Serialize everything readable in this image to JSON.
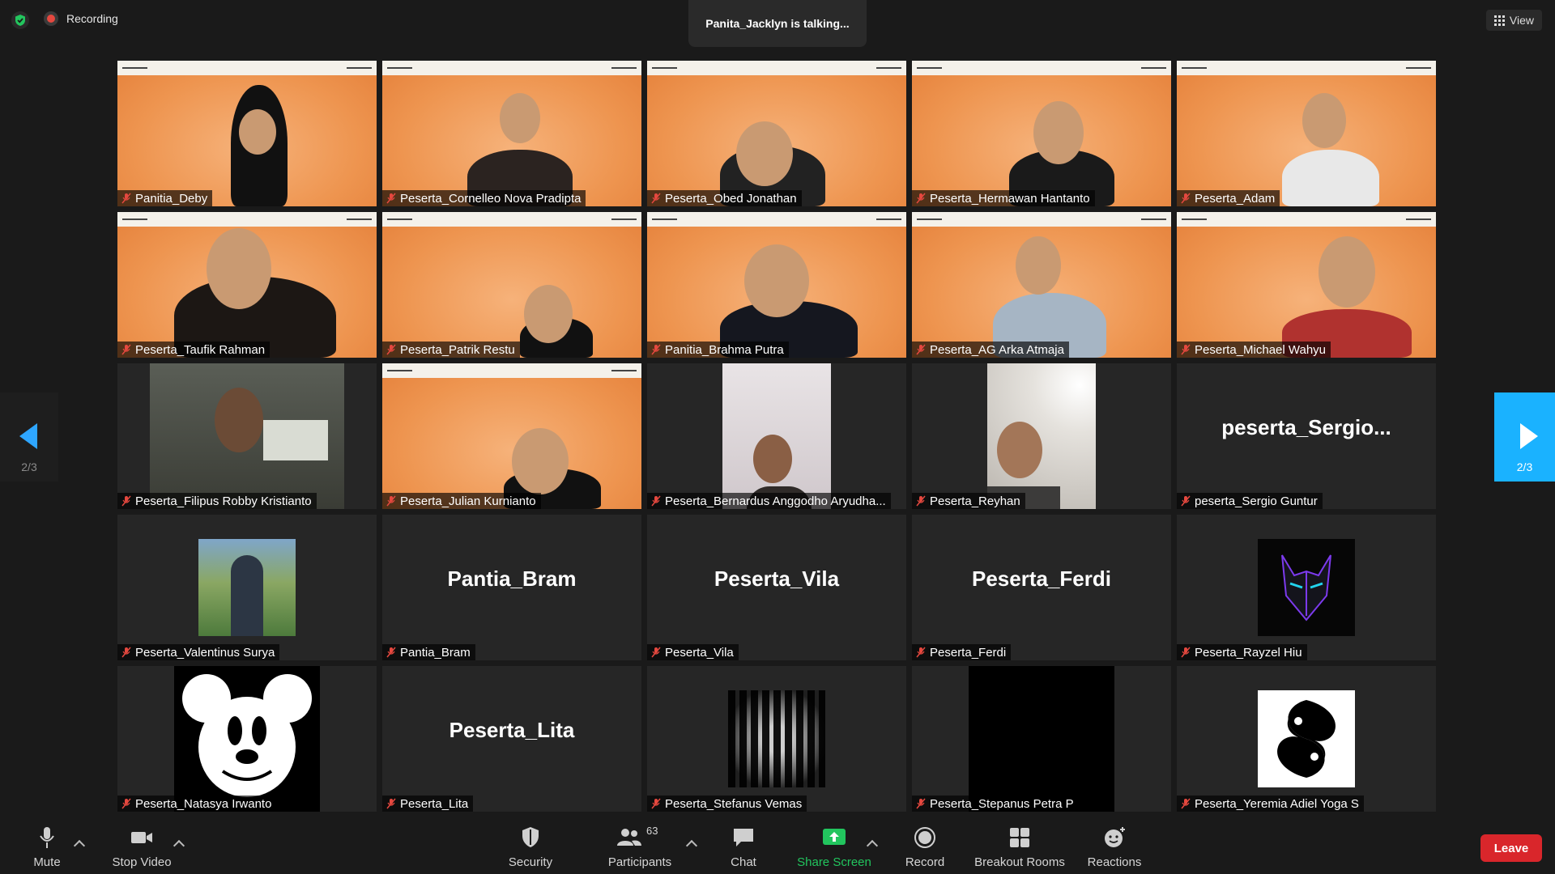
{
  "top": {
    "recording_label": "Recording",
    "talking": "Panita_Jacklyn is talking...",
    "view_label": "View"
  },
  "pager": {
    "left_label": "2/3",
    "right_label": "2/3"
  },
  "tiles": [
    {
      "name": "Panitia_Deby",
      "kind": "video"
    },
    {
      "name": "Peserta_Cornelleo Nova Pradipta",
      "kind": "video"
    },
    {
      "name": "Peserta_Obed Jonathan",
      "kind": "video"
    },
    {
      "name": "Peserta_Hermawan Hantanto",
      "kind": "video"
    },
    {
      "name": "Peserta_Adam",
      "kind": "video"
    },
    {
      "name": "Peserta_Taufik Rahman",
      "kind": "video"
    },
    {
      "name": "Peserta_Patrik Restu",
      "kind": "video"
    },
    {
      "name": "Panitia_Brahma Putra",
      "kind": "video"
    },
    {
      "name": "Peserta_AG Arka Atmaja",
      "kind": "video"
    },
    {
      "name": "Peserta_Michael Wahyu",
      "kind": "video"
    },
    {
      "name": "Peserta_Filipus Robby Kristianto",
      "kind": "video"
    },
    {
      "name": "Peserta_Julian Kurnianto",
      "kind": "video"
    },
    {
      "name": "Peserta_Bernardus Anggodho Aryudha...",
      "kind": "video"
    },
    {
      "name": "Peserta_Reyhan",
      "kind": "video"
    },
    {
      "name": "peserta_Sergio Guntur",
      "kind": "text",
      "display": "peserta_Sergio..."
    },
    {
      "name": "Peserta_Valentinus Surya",
      "kind": "photo"
    },
    {
      "name": "Pantia_Bram",
      "kind": "text",
      "display": "Pantia_Bram"
    },
    {
      "name": "Peserta_Vila",
      "kind": "text",
      "display": "Peserta_Vila"
    },
    {
      "name": "Peserta_Ferdi",
      "kind": "text",
      "display": "Peserta_Ferdi"
    },
    {
      "name": "Peserta_Rayzel Hiu",
      "kind": "photo"
    },
    {
      "name": "Peserta_Natasya Irwanto",
      "kind": "photo"
    },
    {
      "name": "Peserta_Lita",
      "kind": "text",
      "display": "Peserta_Lita"
    },
    {
      "name": "Peserta_Stefanus Vemas",
      "kind": "photo"
    },
    {
      "name": "Peserta_Stepanus Petra P",
      "kind": "video"
    },
    {
      "name": "Peserta_Yeremia Adiel Yoga S",
      "kind": "photo"
    }
  ],
  "toolbar": {
    "mute": "Mute",
    "stop_video": "Stop Video",
    "security": "Security",
    "participants": "Participants",
    "participants_count": "63",
    "chat": "Chat",
    "share_screen": "Share Screen",
    "record": "Record",
    "breakout_rooms": "Breakout Rooms",
    "reactions": "Reactions",
    "leave": "Leave"
  },
  "colors": {
    "share_green": "#22c55e",
    "leave_red": "#d9262b",
    "pager_blue": "#1ab2ff",
    "muted_red": "#e5483f"
  }
}
